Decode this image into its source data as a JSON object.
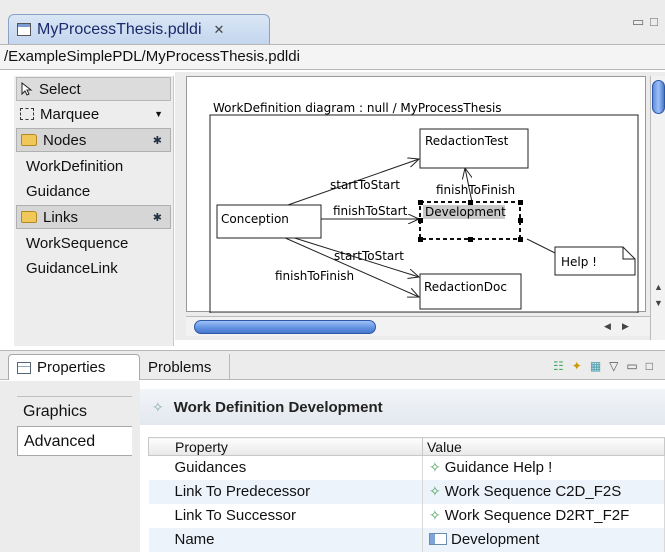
{
  "editor": {
    "tab_title": "MyProcessThesis.pdldi",
    "close_glyph": "✕",
    "path": "/ExampleSimplePDL/MyProcessThesis.pdldi"
  },
  "palette": {
    "select_label": "Select",
    "marquee_label": "Marquee",
    "nodes_label": "Nodes",
    "node_items": [
      "WorkDefinition",
      "Guidance"
    ],
    "links_label": "Links",
    "link_items": [
      "WorkSequence",
      "GuidanceLink"
    ]
  },
  "diagram": {
    "title": "WorkDefinition diagram : null / MyProcessThesis",
    "nodes": {
      "conception": "Conception",
      "development": "Development",
      "redaction_test": "RedactionTest",
      "redaction_doc": "RedactionDoc",
      "help": "Help !"
    },
    "edge_labels": {
      "c2rt": "startToStart",
      "c2d": "finishToStart",
      "d2rt": "finishToFinish",
      "c2rd_s": "startToStart",
      "c2rd_f": "finishToFinish"
    }
  },
  "properties_view": {
    "tab_properties": "Properties",
    "tab_problems": "Problems",
    "side_tabs": [
      "Graphics",
      "Advanced"
    ],
    "header": "Work Definition Development",
    "columns": [
      "Property",
      "Value"
    ],
    "rows": [
      {
        "property": "Guidances",
        "value": "Guidance Help !"
      },
      {
        "property": "Link To Predecessor",
        "value": "Work Sequence C2D_F2S"
      },
      {
        "property": "Link To Successor",
        "value": "Work Sequence D2RT_F2F"
      },
      {
        "property": "Name",
        "value": "Development"
      }
    ]
  },
  "colors": {
    "tab_active": "#c4d6ee",
    "scroll_thumb": "#5f8fe0",
    "selection_fill": "#c9c9c9",
    "alt_row": "#edf3fb",
    "guidance_icon": "#4aa05a"
  }
}
